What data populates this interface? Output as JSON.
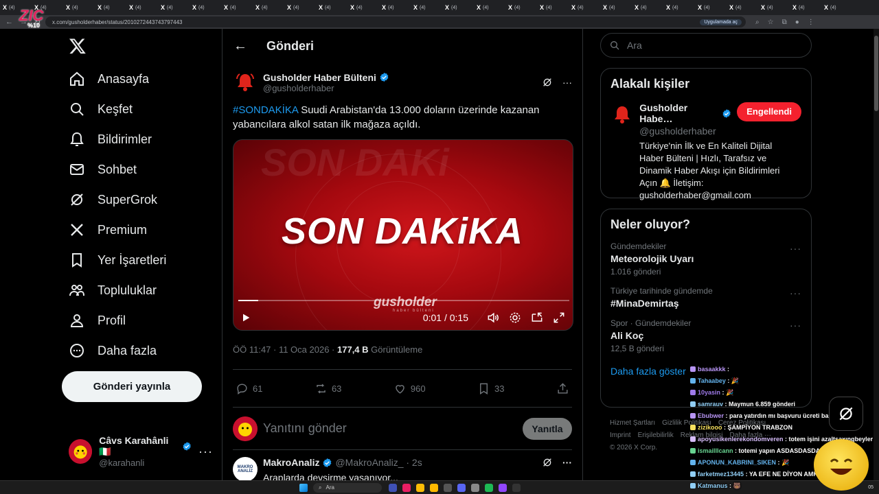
{
  "browser": {
    "tab_label": "(4)",
    "url": "x.com/gusholderhaber/status/2010272443743797443",
    "open_in_app": "Uygulamada aç"
  },
  "stream_logo": {
    "text": "ZIC",
    "sub": "%10"
  },
  "nav": {
    "items": [
      {
        "label": "Anasayfa",
        "icon": "home-icon"
      },
      {
        "label": "Keşfet",
        "icon": "search-icon"
      },
      {
        "label": "Bildirimler",
        "icon": "bell-icon"
      },
      {
        "label": "Sohbet",
        "icon": "mail-icon"
      },
      {
        "label": "SuperGrok",
        "icon": "grok-icon"
      },
      {
        "label": "Premium",
        "icon": "x-icon"
      },
      {
        "label": "Yer İşaretleri",
        "icon": "bookmark-icon"
      },
      {
        "label": "Topluluklar",
        "icon": "communities-icon"
      },
      {
        "label": "Profil",
        "icon": "person-icon"
      },
      {
        "label": "Daha fazla",
        "icon": "more-circle-icon"
      }
    ],
    "post_button": "Gönderi yayınla",
    "account": {
      "name": "Câvs Karahânli 🇮🇹",
      "handle": "@karahanli"
    }
  },
  "main": {
    "header_title": "Gönderi",
    "tweet": {
      "author_name": "Gusholder Haber Bülteni",
      "author_handle": "@gusholderhaber",
      "hashtag": "#SONDAKİKA",
      "text": " Suudi Arabistan'da 13.000 doların üzerinde kazanan yabancılara alkol satan ilk mağaza açıldı.",
      "media": {
        "headline": "SON DAKiKA",
        "ghost": "SON DAKi",
        "brand": "gusholder",
        "brand_sub": "haber bülteni",
        "time": "0:01 / 0:15",
        "progress": 0.06
      },
      "timestamp": "ÖÖ 11:47 · 11 Oca 2026 · ",
      "views_count": "177,4 B",
      "views_label": " Görüntüleme",
      "replies": "61",
      "reposts": "63",
      "likes": "960",
      "bookmarks": "33"
    },
    "reply_placeholder": "Yanıtını gönder",
    "reply_button": "Yanıtla",
    "next_reply": {
      "name": "MakroAnaliz",
      "handle": "@MakroAnaliz_ · 2s",
      "text": "Araplarda devşirme yaşanıyor...",
      "avatar_text": "MAKRO ANALİZ"
    }
  },
  "right": {
    "search_placeholder": "Ara",
    "related": {
      "title": "Alakalı kişiler",
      "name": "Gusholder Habe…",
      "handle": "@gusholderhaber",
      "button": "Engellendi",
      "bio": "Türkiye'nin İlk ve En Kaliteli Dijital Haber Bülteni | Hızlı, Tarafsız ve Dinamik Haber Akışı için Bildirimleri Açın 🔔 İletişim: gusholderhaber@gmail.com"
    },
    "trends": {
      "title": "Neler oluyor?",
      "items": [
        {
          "context": "Gündemdekiler",
          "name": "Meteorolojik Uyarı",
          "count": "1.016 gönderi"
        },
        {
          "context": "Türkiye tarihinde gündemde",
          "name": "#MinaDemirtaş",
          "count": ""
        },
        {
          "context": "Spor · Gündemdekiler",
          "name": "Ali Koç",
          "count": "12,5 B gönderi"
        }
      ],
      "show_more": "Daha fazla göster"
    },
    "footer": {
      "line1": [
        "Hizmet Şartları",
        "Gizlilik Politikası",
        "Çerez Politikası"
      ],
      "line2": [
        "Imprint",
        "Erişilebilirlik",
        "Reklam bilgisi",
        "Daha fazla ···"
      ],
      "copyright": "© 2026 X Corp."
    }
  },
  "chat": [
    {
      "user": "basaakkk",
      "msg": " : ",
      "color": "#b794f4"
    },
    {
      "user": "Tahaabey",
      "msg": " : 🎉",
      "color": "#63b3ed"
    },
    {
      "user": "10yasin",
      "msg": " : 🎉",
      "color": "#9f7aea"
    },
    {
      "user": "samrauv",
      "msg": " : Maymun 6.859 gönderi",
      "color": "#90cdf4"
    },
    {
      "user": "Ebubwer",
      "msg": " : para yatırdın mı başvuru ücreti bankadan",
      "color": "#b794f4"
    },
    {
      "user": "zizikooo",
      "msg": " : ŞAMPİYON TRABZON",
      "color": "#f6e05e"
    },
    {
      "user": "apoyusikenlerekondomveren",
      "msg": " : totem işini azaltsaxıngbeyler",
      "color": "#d6bcfa"
    },
    {
      "user": "ismailllcann",
      "msg": " : totemi yapın ASDASDASDASDSA",
      "color": "#68d391"
    },
    {
      "user": "APONUN_KABRINI_SIKEN",
      "msg": " : 🎉",
      "color": "#63b3ed"
    },
    {
      "user": "farketmez13445",
      "msg": " : YA EFE NE DİYON AMK",
      "color": "#90cdf4"
    },
    {
      "user": "Katmanus",
      "msg": " : 🐻",
      "color": "#90cdf4"
    }
  ],
  "taskbar": {
    "search": "Ara",
    "clock": "05"
  },
  "colors": {
    "accent": "#1d9bf0",
    "danger": "#f4212e",
    "bg": "#000000"
  }
}
